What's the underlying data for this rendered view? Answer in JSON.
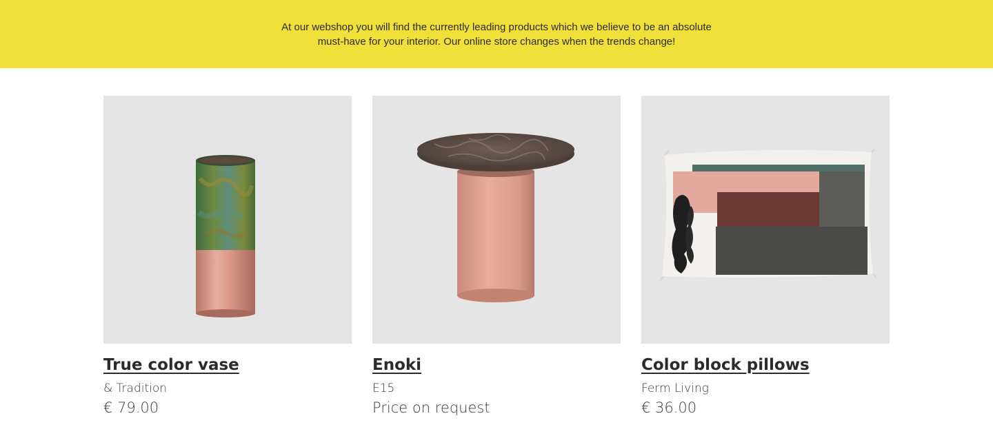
{
  "banner": {
    "line1": "At our webshop you will find the currently leading products which we believe to be an absolute",
    "line2": "must-have for your interior. Our online store changes when the trends change!",
    "background": "#f1e03a"
  },
  "products": [
    {
      "title": "True color vase",
      "brand": "& Tradition",
      "price": "€ 79.00",
      "image": "vase-image"
    },
    {
      "title": "Enoki",
      "brand": "E15",
      "price": "Price on request",
      "image": "side-table-image"
    },
    {
      "title": "Color block pillows",
      "brand": "Ferm Living",
      "price": "€ 36.00",
      "image": "pillow-image"
    }
  ]
}
